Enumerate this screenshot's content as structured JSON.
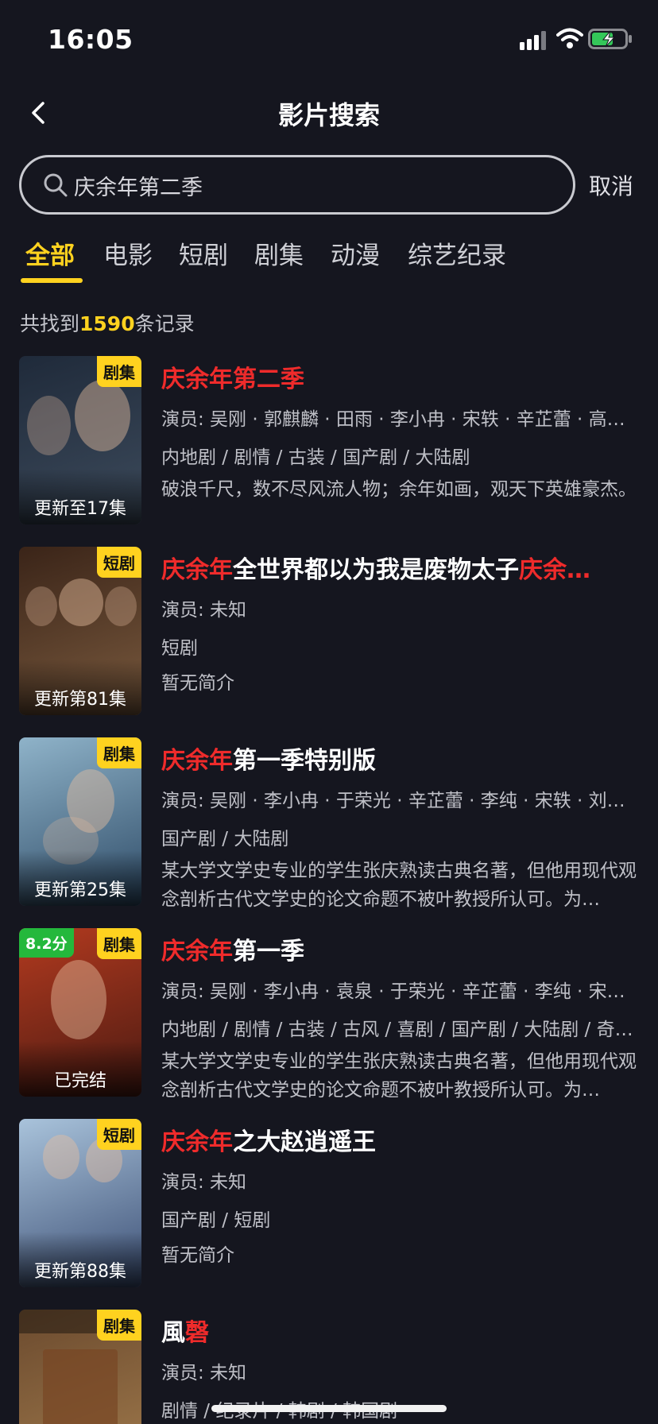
{
  "status_bar": {
    "time": "16:05"
  },
  "header": {
    "title": "影片搜索"
  },
  "search": {
    "value": "庆余年第二季",
    "cancel_label": "取消"
  },
  "tabs": [
    {
      "label": "全部",
      "active": true
    },
    {
      "label": "电影"
    },
    {
      "label": "短剧"
    },
    {
      "label": "剧集"
    },
    {
      "label": "动漫"
    },
    {
      "label": "综艺纪录"
    }
  ],
  "result_summary": {
    "prefix": "共找到",
    "count": "1590",
    "suffix": "条记录"
  },
  "results": [
    {
      "title_parts": [
        {
          "text": "庆余年第二季",
          "highlight": true
        }
      ],
      "badge": "剧集",
      "status": "更新至17集",
      "cast": "演员: 吴刚 · 郭麒麟 · 田雨 · 李小冉 · 宋轶 · 辛芷蕾 · 高…",
      "genres": "内地剧 / 剧情 / 古装 / 国产剧 / 大陆剧",
      "synopsis": "破浪千尺，数不尽风流人物；余年如画，观天下英雄豪杰。",
      "poster_colors": [
        "#1f2a3a",
        "#3d4b5c"
      ]
    },
    {
      "title_parts": [
        {
          "text": "庆余年",
          "highlight": true
        },
        {
          "text": "全世界都以为我是废物太子",
          "highlight": false
        },
        {
          "text": "庆余…",
          "highlight": true
        }
      ],
      "badge": "短剧",
      "status": "更新第81集",
      "cast": "演员: 未知",
      "genres": "短剧",
      "synopsis": "暂无简介",
      "poster_colors": [
        "#3a2418",
        "#7a5a3e"
      ]
    },
    {
      "title_parts": [
        {
          "text": "庆余年",
          "highlight": true
        },
        {
          "text": "第一季特别版",
          "highlight": false
        }
      ],
      "badge": "剧集",
      "status": "更新第25集",
      "cast": "演员: 吴刚 · 李小冉 · 于荣光 · 辛芷蕾 · 李纯 · 宋轶 · 刘…",
      "genres": "国产剧 / 大陆剧",
      "synopsis": "某大学文学史专业的学生张庆熟读古典名著，但他用现代观念剖析古代文学史的论文命题不被叶教授所认可。为…",
      "poster_colors": [
        "#8fb3c9",
        "#2d4a66"
      ]
    },
    {
      "title_parts": [
        {
          "text": "庆余年",
          "highlight": true
        },
        {
          "text": "第一季",
          "highlight": false
        }
      ],
      "badge": "剧集",
      "score": "8.2分",
      "status": "已完结",
      "cast": "演员: 吴刚 · 李小冉 · 袁泉 · 于荣光 · 辛芷蕾 · 李纯 · 宋…",
      "genres": "内地剧 / 剧情 / 古装 / 古风 / 喜剧 / 国产剧 / 大陆剧 / 奇…",
      "synopsis": "某大学文学史专业的学生张庆熟读古典名著，但他用现代观念剖析古代文学史的论文命题不被叶教授所认可。为…",
      "poster_colors": [
        "#b33a1f",
        "#4a1a12"
      ]
    },
    {
      "title_parts": [
        {
          "text": "庆余年",
          "highlight": true
        },
        {
          "text": "之大赵逍遥王",
          "highlight": false
        }
      ],
      "badge": "短剧",
      "status": "更新第88集",
      "cast": "演员: 未知",
      "genres": "国产剧 / 短剧",
      "synopsis": "暂无简介",
      "poster_colors": [
        "#a9c3db",
        "#3b4e74"
      ]
    },
    {
      "title_parts": [
        {
          "text": "風",
          "highlight": false
        },
        {
          "text": "磬",
          "highlight": true
        }
      ],
      "badge": "剧集",
      "cast": "演员: 未知",
      "genres": "剧情 / 纪录片 / 韩剧 / 韩国剧",
      "poster_colors": [
        "#6b4a2e",
        "#a07a4c"
      ]
    }
  ]
}
